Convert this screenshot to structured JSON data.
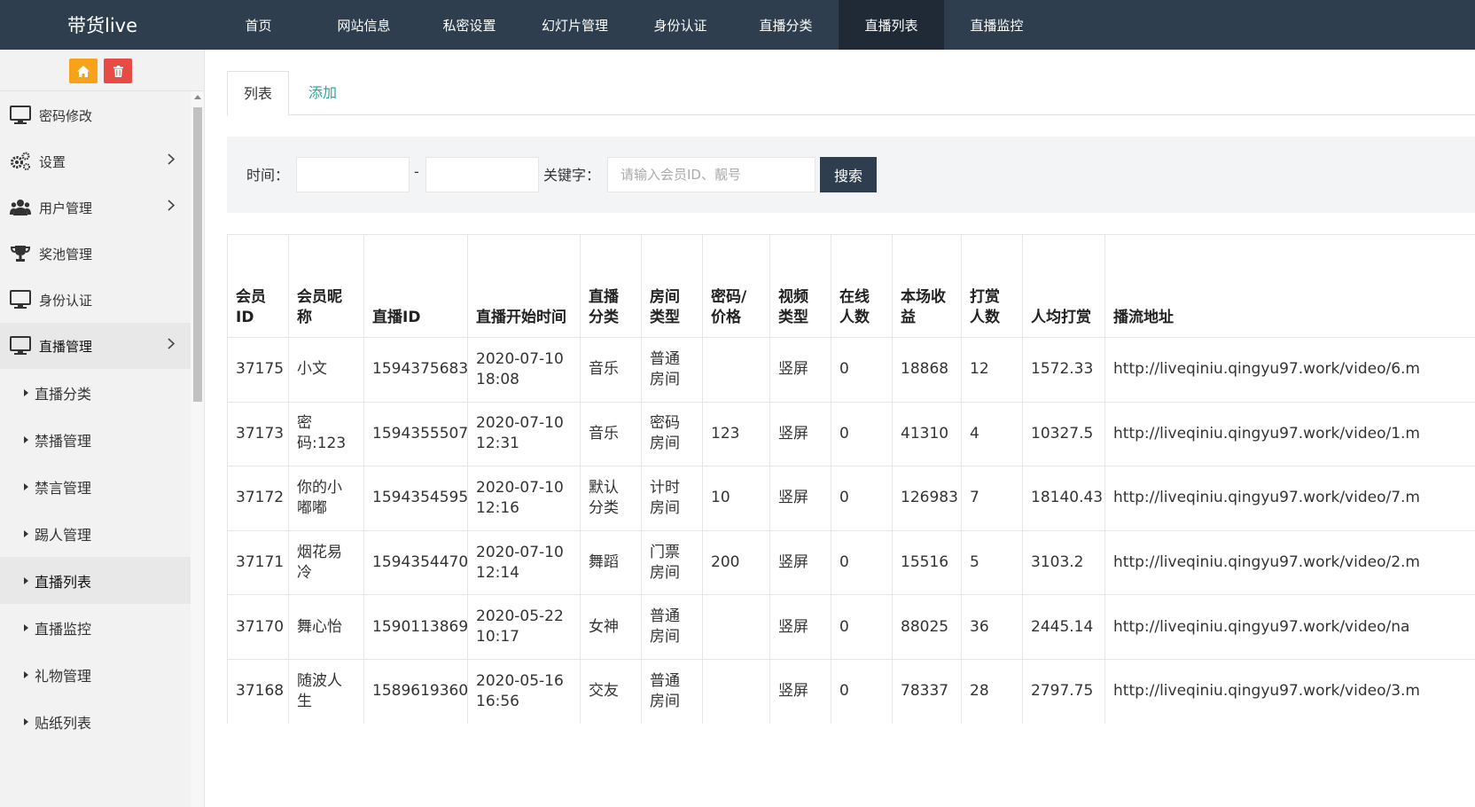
{
  "brand": "带货live",
  "topnav": [
    "首页",
    "网站信息",
    "私密设置",
    "幻灯片管理",
    "身份认证",
    "直播分类",
    "直播列表",
    "直播监控"
  ],
  "topnav_active": 6,
  "colors": {
    "topbar": "#2e3e4e",
    "home_button": "#f7a21b",
    "trash_button": "#e64b45",
    "tab_add": "#26a69a"
  },
  "sidebar": {
    "tools": [
      {
        "name": "home",
        "icon": "home-icon"
      },
      {
        "name": "clear-cache",
        "icon": "trash-icon"
      }
    ],
    "menu": [
      {
        "label": "密码修改",
        "icon": "monitor-icon",
        "has_arrow": false
      },
      {
        "label": "设置",
        "icon": "gears-icon",
        "has_arrow": true
      },
      {
        "label": "用户管理",
        "icon": "users-icon",
        "has_arrow": true
      },
      {
        "label": "奖池管理",
        "icon": "trophy-icon",
        "has_arrow": false
      },
      {
        "label": "身份认证",
        "icon": "monitor-icon",
        "has_arrow": false
      },
      {
        "label": "直播管理",
        "icon": "monitor-icon",
        "has_arrow": true
      }
    ],
    "submenu": [
      "直播分类",
      "禁播管理",
      "禁言管理",
      "踢人管理",
      "直播列表",
      "直播监控",
      "礼物管理",
      "贴纸列表"
    ],
    "submenu_active": 4
  },
  "tabs": {
    "list": "列表",
    "add": "添加"
  },
  "filter": {
    "time_label": "时间：",
    "separator": "-",
    "start_value": "",
    "end_value": "",
    "keyword_label": "关键字：",
    "keyword_placeholder": "请输入会员ID、靓号",
    "keyword_value": "",
    "search_label": "搜索"
  },
  "table": {
    "columns": [
      "会员ID",
      "会员昵称",
      "直播ID",
      "直播开始时间",
      "直播分类",
      "房间类型",
      "密码/价格",
      "视频类型",
      "在线人数",
      "本场收益",
      "打赏人数",
      "人均打赏",
      "播流地址"
    ],
    "rows": [
      [
        "37175",
        "小文",
        "1594375683",
        "2020-07-10 18:08",
        "音乐",
        "普通房间",
        "",
        "竖屏",
        "0",
        "18868",
        "12",
        "1572.33",
        "http://liveqiniu.qingyu97.work/video/6.m"
      ],
      [
        "37173",
        "密码:123",
        "1594355507",
        "2020-07-10 12:31",
        "音乐",
        "密码房间",
        "123",
        "竖屏",
        "0",
        "41310",
        "4",
        "10327.5",
        "http://liveqiniu.qingyu97.work/video/1.m"
      ],
      [
        "37172",
        "你的小嘟嘟",
        "1594354595",
        "2020-07-10 12:16",
        "默认分类",
        "计时房间",
        "10",
        "竖屏",
        "0",
        "126983",
        "7",
        "18140.43",
        "http://liveqiniu.qingyu97.work/video/7.m"
      ],
      [
        "37171",
        "烟花易冷",
        "1594354470",
        "2020-07-10 12:14",
        "舞蹈",
        "门票房间",
        "200",
        "竖屏",
        "0",
        "15516",
        "5",
        "3103.2",
        "http://liveqiniu.qingyu97.work/video/2.m"
      ],
      [
        "37170",
        "舞心怡",
        "1590113869",
        "2020-05-22 10:17",
        "女神",
        "普通房间",
        "",
        "竖屏",
        "0",
        "88025",
        "36",
        "2445.14",
        "http://liveqiniu.qingyu97.work/video/na"
      ],
      [
        "37168",
        "随波人生",
        "1589619360",
        "2020-05-16 16:56",
        "交友",
        "普通房间",
        "",
        "竖屏",
        "0",
        "78337",
        "28",
        "2797.75",
        "http://liveqiniu.qingyu97.work/video/3.m"
      ]
    ]
  }
}
